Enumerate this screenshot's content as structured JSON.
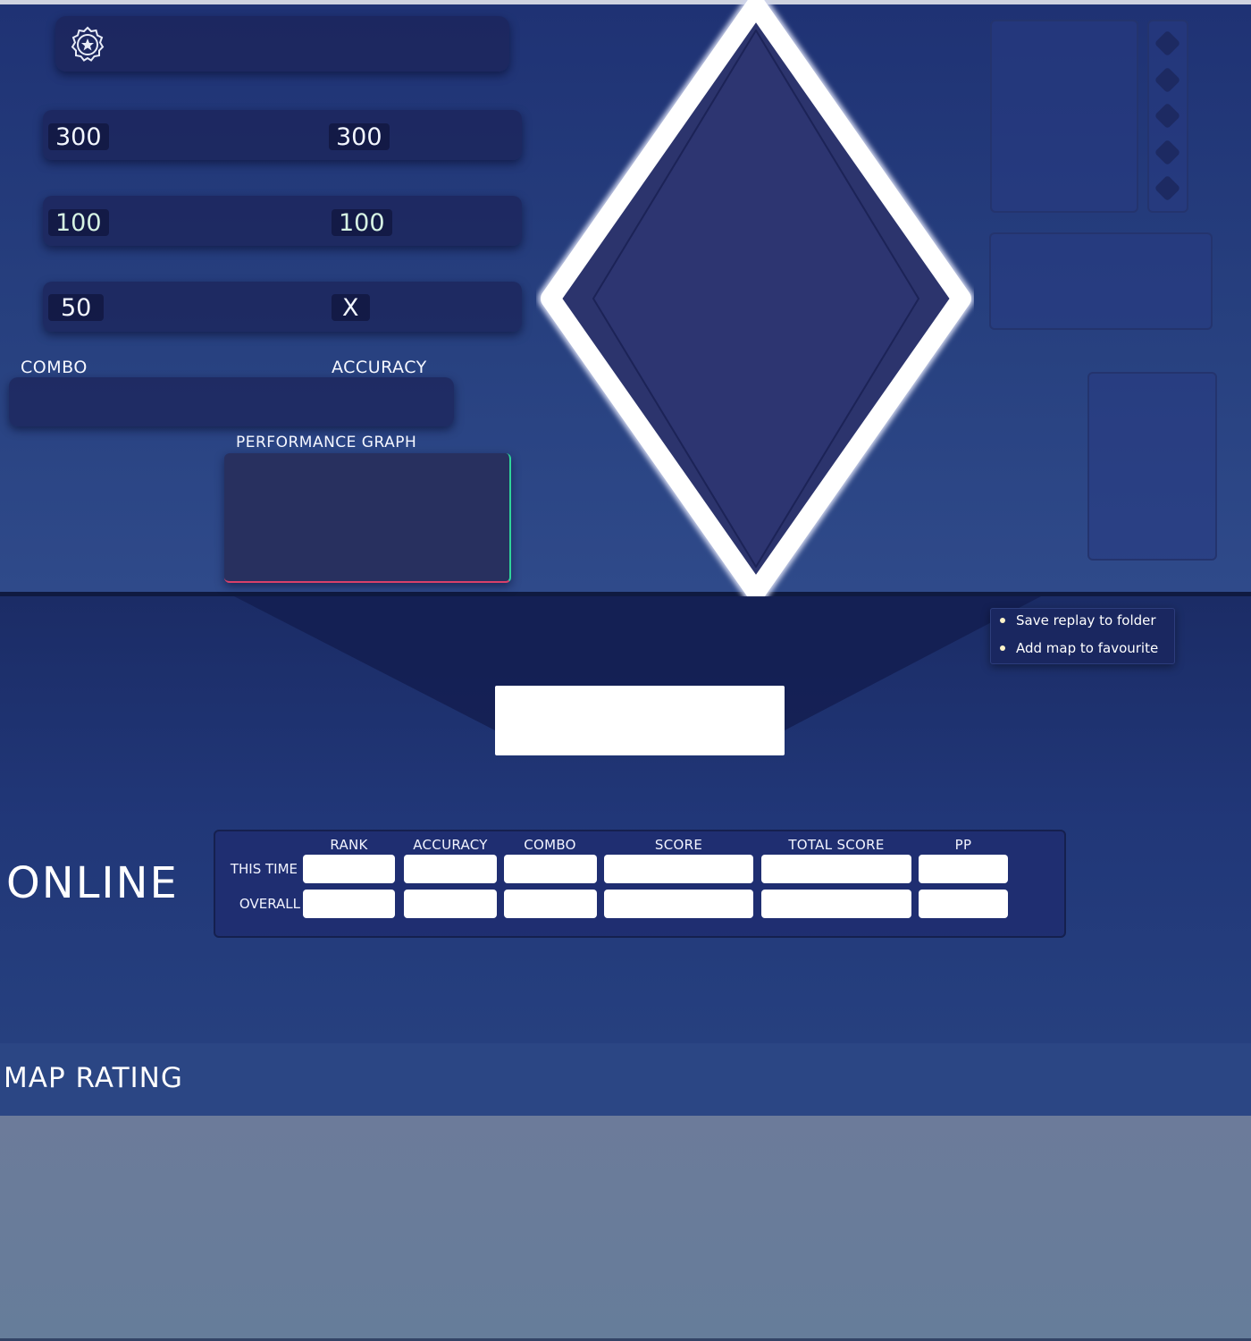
{
  "counts": {
    "left_300": "300",
    "right_300": "300",
    "left_100": "100",
    "right_100": "100",
    "left_50": "50",
    "miss": "X"
  },
  "labels": {
    "combo": "COMBO",
    "accuracy": "ACCURACY",
    "performance_graph": "PERFORMANCE GRAPH"
  },
  "context_menu": {
    "items": [
      "Save replay to folder",
      "Add map to favourite"
    ]
  },
  "online": {
    "title": "ONLINE",
    "columns": [
      "RANK",
      "ACCURACY",
      "COMBO",
      "SCORE",
      "TOTAL SCORE",
      "PP"
    ],
    "rows": [
      "THIS TIME",
      "OVERALL"
    ]
  },
  "map_rating": {
    "title": "MAP RATING"
  },
  "icons": {
    "badge": "star-badge-icon",
    "bullet": "bullet-dot-icon"
  },
  "colors": {
    "background": "#24397a",
    "panel": "#1c245a",
    "accent_white": "#ffffff",
    "graph_green": "#2fd39a",
    "graph_red": "#d8406a"
  }
}
